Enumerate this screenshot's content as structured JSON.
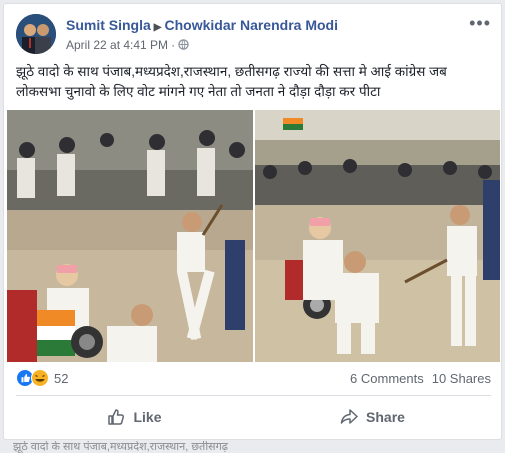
{
  "post": {
    "author": "Sumit Singla",
    "target_page": "Chowkidar Narendra Modi",
    "date": "April 22 at 4:41 PM",
    "privacy_icon": "globe-icon",
    "text": "झूठे वादो के साथ पंजाब,मध्यप्रदेश,राजस्थान, छतीसगढ़ राज्यो की सत्ता मे आई कांग्रेस जब लोकसभा चुनावो के लिए वोट मांगने गए नेता तो जनता ने दौड़ा दौड़ा कर पीटा"
  },
  "photos": [
    {
      "name": "photo-left",
      "description_icon": "photo"
    },
    {
      "name": "photo-right",
      "description_icon": "photo"
    }
  ],
  "stats": {
    "reactions_count": "52",
    "comments": "6 Comments",
    "shares": "10 Shares"
  },
  "actions": {
    "like_label": "Like",
    "share_label": "Share"
  },
  "bottom_strip": {
    "text": "झूठे वादो के साथ पंजाब,मध्यप्रदेश,राजस्थान, छतीसगढ़"
  },
  "colors": {
    "link": "#385898",
    "like_blue": "#1877f2",
    "haha_yellow": "#f7b125"
  }
}
